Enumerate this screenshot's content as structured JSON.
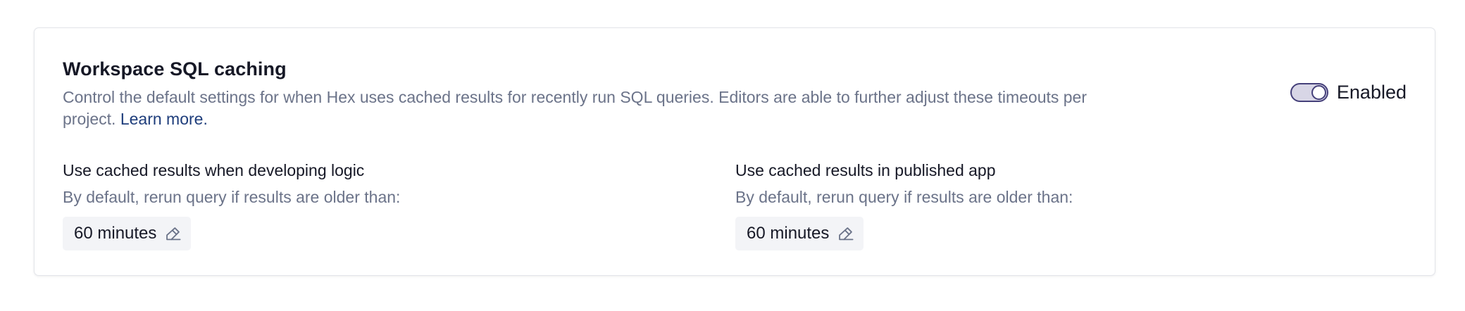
{
  "section": {
    "title": "Workspace SQL caching",
    "description": "Control the default settings for when Hex uses cached results for recently run SQL queries. Editors are able to further adjust these timeouts per project.",
    "learn_more": "Learn more.",
    "toggle": {
      "label": "Enabled",
      "state": "on",
      "accent_color": "#45407a"
    }
  },
  "settings": [
    {
      "title": "Use cached results when developing logic",
      "subtitle": "By default, rerun query if results are older than:",
      "value": "60 minutes",
      "icon": "pencil-icon"
    },
    {
      "title": "Use cached results in published app",
      "subtitle": "By default, rerun query if results are older than:",
      "value": "60 minutes",
      "icon": "pencil-icon"
    }
  ]
}
